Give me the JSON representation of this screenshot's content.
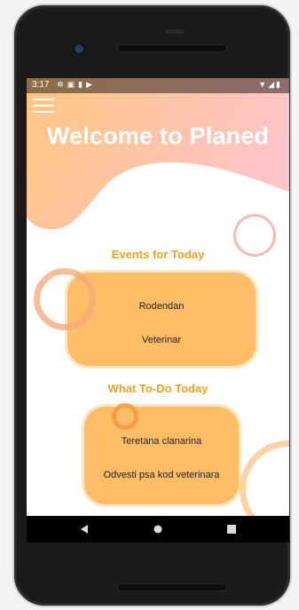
{
  "status_bar": {
    "time": "3:17",
    "left_icons": [
      "settings-icon",
      "notification-icon",
      "sd-card-icon",
      "play-icon"
    ],
    "right_icons": [
      "wifi-icon",
      "signal-icon",
      "battery-icon"
    ]
  },
  "header": {
    "title": "Welcome to Planed",
    "menu_icon": "hamburger-menu-icon"
  },
  "events": {
    "title": "Events for Today",
    "items": [
      "Rodendan",
      "Veterinar"
    ]
  },
  "todos": {
    "title": "What To-Do Today",
    "items": [
      "Teretana clanarina",
      "Odvesti psa kod veterinara"
    ]
  },
  "nav_bar": {
    "back_icon": "back-icon",
    "home_icon": "home-icon",
    "recents_icon": "recents-icon"
  },
  "colors": {
    "accent_orange": "#f7a21d",
    "card_fill": "#ffb24d",
    "header_gradient_start": "#ffc680",
    "header_gradient_end": "#ffc4c8"
  }
}
